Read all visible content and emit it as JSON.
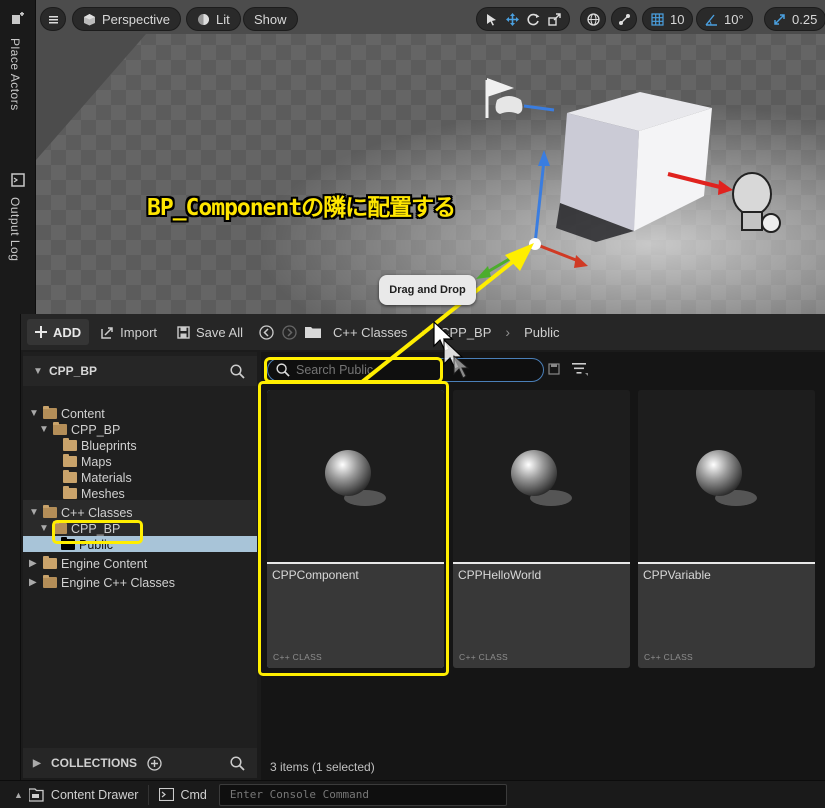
{
  "left_tabs": {
    "place_actors": "Place Actors",
    "output_log": "Output Log"
  },
  "viewport": {
    "perspective": "Perspective",
    "lit": "Lit",
    "show": "Show",
    "grid_value": "10",
    "angle_value": "10°",
    "scale_value": "0.25"
  },
  "annotation": {
    "text": "BP_Componentの隣に配置する"
  },
  "tooltip": {
    "text": "Drag and Drop"
  },
  "drawer": {
    "add_label": "ADD",
    "import_label": "Import",
    "save_all_label": "Save All",
    "breadcrumb": [
      "C++ Classes",
      "CPP_BP",
      "Public"
    ]
  },
  "tree": {
    "header": "CPP_BP",
    "items": [
      "Content",
      "CPP_BP",
      "Blueprints",
      "Maps",
      "Materials",
      "Meshes",
      "C++ Classes",
      "CPP_BP",
      "Public",
      "Engine Content",
      "Engine C++ Classes"
    ],
    "collections_label": "COLLECTIONS"
  },
  "search": {
    "placeholder": "Search Public"
  },
  "assets": [
    {
      "name": "CPPComponent",
      "type": "C++ CLASS"
    },
    {
      "name": "CPPHelloWorld",
      "type": "C++ CLASS"
    },
    {
      "name": "CPPVariable",
      "type": "C++ CLASS"
    }
  ],
  "status_text": "3 items (1 selected)",
  "bottom": {
    "content_drawer": "Content Drawer",
    "cmd": "Cmd",
    "console_placeholder": "Enter Console Command"
  },
  "colors": {
    "highlight": "#ffee00",
    "selection": "#4aa0e0",
    "folder": "#c9a36b"
  },
  "icons": [
    "menu-icon",
    "perspective-cube-icon",
    "lit-icon",
    "select-icon",
    "move-icon",
    "rotate-icon",
    "scale-icon",
    "world-icon",
    "snap-icon",
    "grid-icon",
    "angle-icon",
    "scale-snap-icon",
    "search-icon",
    "filter-icon",
    "save-icon",
    "back-icon",
    "forward-icon",
    "add-icon",
    "import-icon",
    "folder-icon",
    "sphere-thumbnail-icon",
    "flag-icon",
    "lightbulb-icon",
    "cursor-icon"
  ]
}
